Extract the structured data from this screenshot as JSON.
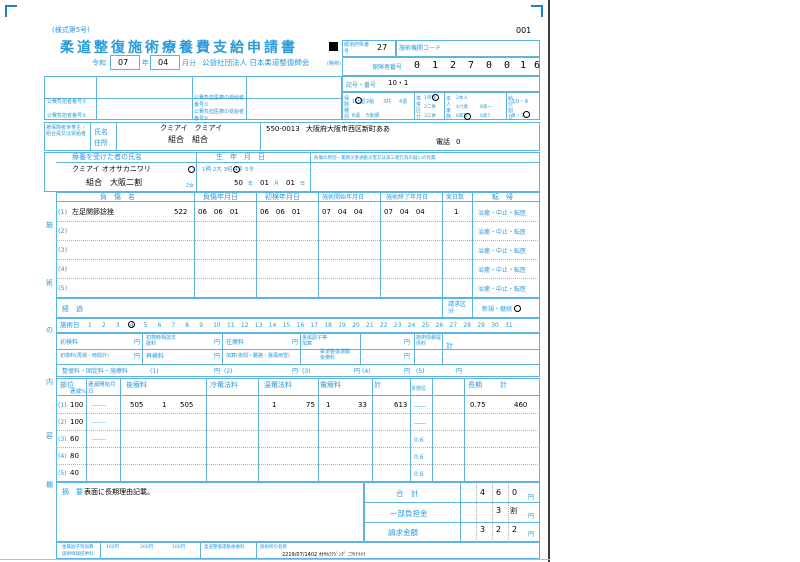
{
  "header": {
    "form_no": "(様式第5号)",
    "top_number": "001",
    "title": "柔道整復施術療養費支給申請書",
    "era": "令和",
    "year": "07",
    "year_unit": "年",
    "month": "04",
    "month_unit": "月分",
    "association": "公益社団法人 日本柔道整復師会",
    "association_suffix": "(略称)",
    "ichiran_label": "都道府県番号",
    "ichiran_value": "27",
    "institution_code_label": "施術機関コード",
    "insurer_no_label": "保険者番号",
    "insurer_digits": [
      "0",
      "1",
      "2",
      "7",
      "0",
      "0",
      "1",
      "6"
    ],
    "kigo_label": "記号・番号",
    "kigo_value": "10・1"
  },
  "public": {
    "payer1": "公費負担者番号①",
    "payer2": "公費負担者番号②",
    "recipient1": "公費負担医療の受給者番号①",
    "recipient2": "公費負担医療の受給者番号②"
  },
  "insurance_type": {
    "label1": "保険種別",
    "label2": "単併区分",
    "label3": "本人家族",
    "opt1": "1社国",
    "opt2": "2組",
    "opt3": "3共",
    "opt4": "4退",
    "opt5": "5後期",
    "opt6": "6退",
    "teihatsu1": "1単独",
    "teihatsu2": "2二併",
    "teihatsu3": "3三併",
    "family1": "2本人",
    "family2": "4六歳",
    "family3": "6家族",
    "family4": "8高一",
    "family5": "0高7",
    "kyufu_label": "給付割合",
    "kyufu_value": "10・9",
    "kyufu2": "8・7"
  },
  "insured": {
    "section_label": "被保険者世帯主・組合員又は受給者",
    "name_label": "氏名",
    "address_label": "住所",
    "name_kana": "クミアイ　クミアイ",
    "name": "組合　組合",
    "postal": "550-0013",
    "address": "大阪府大阪市西区新町ああ",
    "phone_label": "電話",
    "phone": "0"
  },
  "patient": {
    "section_label": "療養を受けた者の氏名",
    "birth_label": "生　年　月　日",
    "reason_label": "負傷の原因・業務災害通勤災害又は第三者行為の疑いの有無",
    "name_kana": "クミアイ オオサカニワリ",
    "name": "組合　大阪二割",
    "sex_label": "1男 2女",
    "sex2": "2女",
    "era_label": "1明 2大 3昭 4平 5令",
    "birth_year": "50",
    "birth_year_unit": "年",
    "birth_month": "01",
    "birth_month_unit": "月",
    "birth_day": "01",
    "birth_day_unit": "日"
  },
  "injury_headers": {
    "name": "負　傷　名",
    "date": "負傷年月日",
    "first": "初検年月日",
    "start": "施術開始年月日",
    "end": "施術終了年月日",
    "days": "実日数",
    "outcome": "転　帰"
  },
  "injuries": [
    {
      "no": "(1)",
      "name": "左足関節捻挫",
      "code": "522",
      "date": "06　06　01",
      "first": "06　06　01",
      "start": "07　04　04",
      "end": "07　04　04",
      "days": "1",
      "outcome": "治癒・中止・転医"
    },
    {
      "no": "(2)",
      "name": "",
      "code": "",
      "date": "",
      "first": "",
      "start": "",
      "end": "",
      "days": "",
      "outcome": "治癒・中止・転医"
    },
    {
      "no": "(3)",
      "name": "",
      "code": "",
      "date": "",
      "first": "",
      "start": "",
      "end": "",
      "days": "",
      "outcome": "治癒・中止・転医"
    },
    {
      "no": "(4)",
      "name": "",
      "code": "",
      "date": "",
      "first": "",
      "start": "",
      "end": "",
      "days": "",
      "outcome": "治癒・中止・転医"
    },
    {
      "no": "(5)",
      "name": "",
      "code": "",
      "date": "",
      "first": "",
      "start": "",
      "end": "",
      "days": "",
      "outcome": "治癒・中止・転医"
    }
  ],
  "side_labels": [
    "施",
    "術",
    "の",
    "内",
    "容",
    "欄"
  ],
  "keika": {
    "label": "経　過",
    "seikyu_label": "請求区分",
    "seikyu_value": "新規・継続"
  },
  "days_row": {
    "label": "施術日",
    "days": [
      "1",
      "2",
      "3",
      "4",
      "5",
      "6",
      "7",
      "8",
      "9",
      "10",
      "11",
      "12",
      "13",
      "14",
      "15",
      "16",
      "17",
      "18",
      "19",
      "20",
      "21",
      "22",
      "23",
      "24",
      "25",
      "26",
      "27",
      "28",
      "29",
      "30",
      "31"
    ],
    "circled": "4"
  },
  "fees": {
    "r1": [
      "初検料",
      "円",
      "初検時相談支援料",
      "円",
      "往療料",
      "円",
      "加算",
      "円",
      "金属副子等加算",
      "円",
      "施術情報提供料",
      "円",
      "計",
      "円"
    ],
    "r2": [
      "初検料(再検・時間外)",
      "円",
      "再検料",
      "円",
      "往療料",
      "円",
      "加算(夜間・難路・暴風雨雪)",
      "円",
      "柔道整復運動後療料",
      "円"
    ],
    "r3": [
      "整復料・固定料・施療料",
      "(1)",
      "円",
      "(2)",
      "円",
      "(3)",
      "円",
      "(4)",
      "円",
      "(5)",
      "円"
    ]
  },
  "detail_headers": {
    "part": "部位",
    "rate": "逓減%",
    "teigen": "逓減開始月日",
    "koryo": "後療料",
    "reiho": "冷罨法料",
    "onpo": "温罨法料",
    "denryo": "電療料",
    "kei": "計",
    "tabui": "多部位",
    "choki": "長期",
    "kei2": "計"
  },
  "details": [
    {
      "part": "(1)",
      "rate": "100",
      "teigen": "——",
      "koryo": "505",
      "k1": "1",
      "k2": "505",
      "reiho": "",
      "onpo": "1",
      "onpo2": "75",
      "denryo": "1",
      "denryo2": "33",
      "kei": "613",
      "tabui": "——",
      "choki": "0.75",
      "total": "460"
    },
    {
      "part": "(2)",
      "rate": "100",
      "teigen": "——",
      "koryo": "",
      "k1": "",
      "k2": "",
      "reiho": "",
      "onpo": "",
      "onpo2": "",
      "denryo": "",
      "denryo2": "",
      "kei": "",
      "tabui": "——",
      "choki": "",
      "total": ""
    },
    {
      "part": "(3)",
      "rate": "60",
      "teigen": "——",
      "koryo": "",
      "k1": "",
      "k2": "",
      "reiho": "",
      "onpo": "",
      "onpo2": "",
      "denryo": "",
      "denryo2": "",
      "kei": "",
      "tabui": "0.6",
      "choki": "",
      "total": ""
    },
    {
      "part": "(4)",
      "rate": "80",
      "teigen": "",
      "koryo": "",
      "k1": "",
      "k2": "",
      "reiho": "",
      "onpo": "",
      "onpo2": "",
      "denryo": "",
      "denryo2": "",
      "kei": "",
      "tabui": "0.6",
      "choki": "",
      "total": ""
    },
    {
      "part": "(5)",
      "rate": "40",
      "teigen": "",
      "koryo": "",
      "k1": "",
      "k2": "",
      "reiho": "",
      "onpo": "",
      "onpo2": "",
      "denryo": "",
      "denryo2": "",
      "kei": "",
      "tabui": "0.6",
      "choki": "",
      "total": ""
    }
  ],
  "summary": {
    "tekiyo_label": "摘　要",
    "tekiyo": "表面に長期理由記載。",
    "gokei_label": "合　計",
    "gokei": [
      "4",
      "6",
      "0"
    ],
    "futan_label": "一部負担金",
    "futan": "3",
    "futan_unit": "割",
    "seikyu_label": "請求金額",
    "seikyu": [
      "3",
      "2",
      "2"
    ],
    "yen": "円"
  },
  "footer": {
    "f1": "金属副子等加算",
    "f2": "施術情報提供料",
    "f3": "100円",
    "f4": "200円",
    "f5": "100円",
    "f6": "柔道整復運動後療料",
    "f7": "施術所の名称",
    "stamp": "2219/07/1402 ｵｵｻｶﾌｸｼﾞﾝｸﾞ ﾆﾜﾘﾃｲﾒｲ"
  }
}
